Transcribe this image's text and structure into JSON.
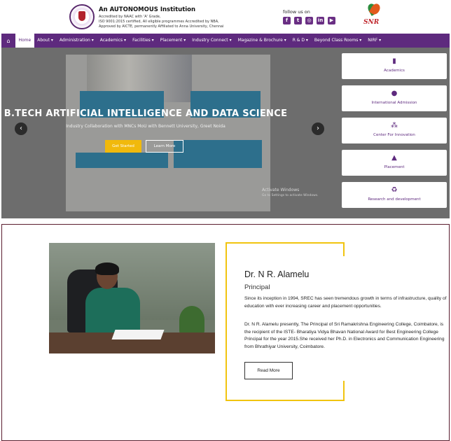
{
  "header": {
    "institution_title": "An AUTONOMOUS Institution",
    "accreditation_lines": [
      "Accredited by NAAC with 'A' Grade,",
      "ISO 9001:2015 certified, All eligible programmes Accredited by NBA,",
      "Approved by AICTE, permanently Affiliated to Anna University, Chennai"
    ],
    "follow_label": "follow us on",
    "social_icons": [
      "facebook-icon",
      "twitter-icon",
      "instagram-icon",
      "linkedin-icon",
      "youtube-icon"
    ],
    "social_glyphs": [
      "f",
      "t",
      "◎",
      "in",
      "▶"
    ],
    "snr_logo_text": "SNR"
  },
  "nav": {
    "home_icon": "home-icon",
    "items": [
      {
        "label": "Home",
        "active": true
      },
      {
        "label": "About ▾",
        "active": false
      },
      {
        "label": "Administration ▾",
        "active": false
      },
      {
        "label": "Academics ▾",
        "active": false
      },
      {
        "label": "Facilities ▾",
        "active": false
      },
      {
        "label": "Placement ▾",
        "active": false
      },
      {
        "label": "Industry Connect ▾",
        "active": false
      },
      {
        "label": "Magazine & Brochure ▾",
        "active": false
      },
      {
        "label": "R & D ▾",
        "active": false
      },
      {
        "label": "Beyond Class Rooms ▾",
        "active": false
      },
      {
        "label": "NIRF ▾",
        "active": false
      }
    ]
  },
  "hero": {
    "title": "B.TECH ARTIFICIAL INTELLIGENCE AND DATA SCIENCE",
    "subtitle": "Industry Collaboration with MNCs MoU with Bennett University, Greet Noida",
    "start_button": "Get Started",
    "learn_button": "Learn More",
    "prev_arrow": "‹",
    "next_arrow": "›",
    "activate_title": "Activate Windows",
    "activate_sub": "Go to Settings to activate Windows.",
    "cards": [
      {
        "label": "Academics",
        "icon": "book-icon",
        "glyph": "▮"
      },
      {
        "label": "International Admission",
        "icon": "globe-icon",
        "glyph": "●"
      },
      {
        "label": "Center For Innovation",
        "icon": "cubes-icon",
        "glyph": "⁂"
      },
      {
        "label": "Placement",
        "icon": "graduation-cap-icon",
        "glyph": "▲"
      },
      {
        "label": "Research and development",
        "icon": "recycle-icon",
        "glyph": "♻"
      }
    ]
  },
  "principal": {
    "name": "Dr. N R. Alamelu",
    "role": "Principal",
    "paragraph1": "Since its inception in 1994, SREC has seen tremendous growth in terms of infrastructure, quality of education with ever increasing career and placement opportunities.",
    "paragraph2": "Dr. N R. Alamelu presently, The Principal of Sri Ramakrishna Engineering College, Coimbatore, is the recipient of the ISTE- Bharatiya Vidya Bhavan National Award for Best Engineering College Principal for the year 2015.She received her Ph.D. in Electronics and Communication Engineering from Bhrathiyar University, Coimbatore.",
    "read_more": "Read More"
  }
}
